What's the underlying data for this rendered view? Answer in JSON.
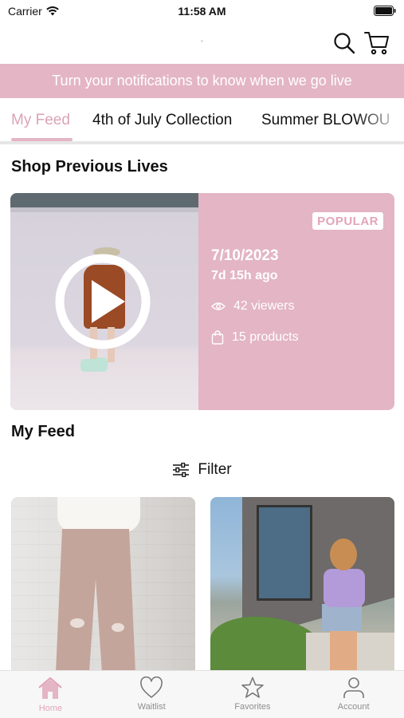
{
  "status_bar": {
    "carrier": "Carrier",
    "time": "11:58 AM"
  },
  "header": {
    "search_icon": "search-icon",
    "cart_icon": "cart-icon"
  },
  "notification_banner": {
    "text": "Turn your notifications to know when we go live"
  },
  "tabs": [
    {
      "label": "My Feed",
      "active": true
    },
    {
      "label": "4th of July Collection",
      "active": false
    },
    {
      "label": "Summer BLOWOU",
      "active": false
    }
  ],
  "shop_previous": {
    "title": "Shop Previous Lives",
    "card": {
      "badge": "POPULAR",
      "date": "7/10/2023",
      "ago": "7d 15h ago",
      "viewers": "42 viewers",
      "products": "15 products"
    }
  },
  "my_feed": {
    "title": "My Feed",
    "filter_label": "Filter"
  },
  "tab_bar": {
    "items": [
      {
        "label": "Home",
        "icon": "home-icon",
        "active": true
      },
      {
        "label": "Waitlist",
        "icon": "heart-icon",
        "active": false
      },
      {
        "label": "Favorites",
        "icon": "star-icon",
        "active": false
      },
      {
        "label": "Account",
        "icon": "person-icon",
        "active": false
      }
    ]
  },
  "colors": {
    "accent_pink": "#e3b5c5",
    "active_pink": "#dba3b7"
  }
}
